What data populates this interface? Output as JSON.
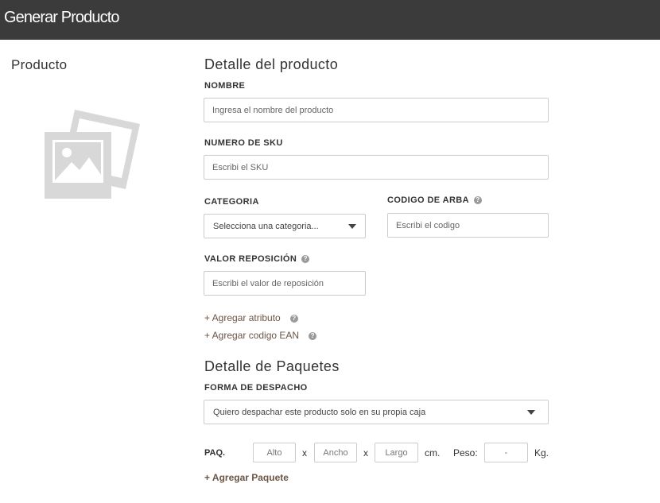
{
  "header": {
    "title": "Generar Producto"
  },
  "sidebar": {
    "title": "Producto"
  },
  "product_detail": {
    "title": "Detalle del producto",
    "nombre": {
      "label": "NOMBRE",
      "placeholder": "Ingresa el nombre del producto",
      "value": ""
    },
    "sku": {
      "label": "NUMERO DE SKU",
      "placeholder": "Escribi el SKU",
      "value": ""
    },
    "categoria": {
      "label": "CATEGORIA",
      "selected": "Selecciona una categoria..."
    },
    "arba": {
      "label": "CODIGO DE ARBA",
      "placeholder": "Escribi el codigo",
      "value": ""
    },
    "reposicion": {
      "label": "VALOR REPOSICIÓN",
      "placeholder": "Escribi el valor de reposición",
      "value": ""
    },
    "add_attribute": "+ Agregar atributo",
    "add_ean": "+ Agregar codigo EAN"
  },
  "package_detail": {
    "title": "Detalle de Paquetes",
    "forma_despacho": {
      "label": "FORMA DE DESPACHO",
      "selected": "Quiero despachar este producto solo en su propia caja"
    },
    "paq_label": "PAQ.",
    "alto_placeholder": "Alto",
    "ancho_placeholder": "Ancho",
    "largo_placeholder": "Largo",
    "sep": "x",
    "cm": "cm.",
    "peso_label": "Peso:",
    "peso_placeholder": "-",
    "kg": "Kg.",
    "add_package": "+ Agregar Paquete"
  },
  "icons": {
    "help": "help-circle-icon",
    "caret": "caret-down-icon",
    "image": "image-placeholder-icon"
  },
  "colors": {
    "header_bg": "#3b3b3b",
    "link": "#6b5545",
    "border": "#cccccc"
  }
}
